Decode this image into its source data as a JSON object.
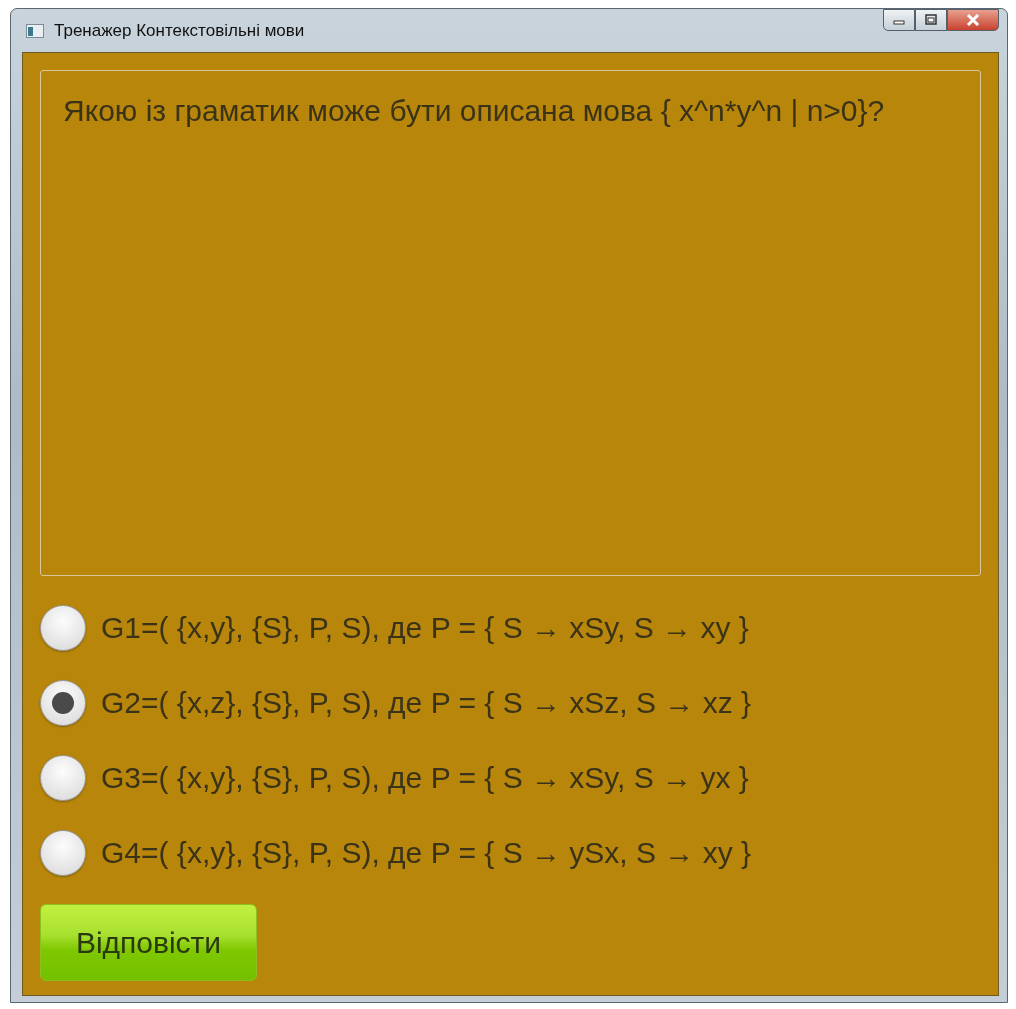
{
  "window": {
    "title": "Тренажер Контекстовільні мови"
  },
  "question": "Якою із граматик може бути описана мова { x^n*y^n | n>0}?",
  "options": [
    {
      "label": "G1=( {x,y}, {S}, P, S), де P = { S → xSy, S → xy }",
      "selected": false
    },
    {
      "label": "G2=( {x,z}, {S}, P, S), де P = { S → xSz, S →  xz }",
      "selected": true
    },
    {
      "label": "G3=( {x,y}, {S}, P, S), де P = { S → xSy, S → yx }",
      "selected": false
    },
    {
      "label": "G4=( {x,y}, {S}, P, S), де P = { S → ySx, S → xy }",
      "selected": false
    }
  ],
  "submit_button": "Відповісти"
}
